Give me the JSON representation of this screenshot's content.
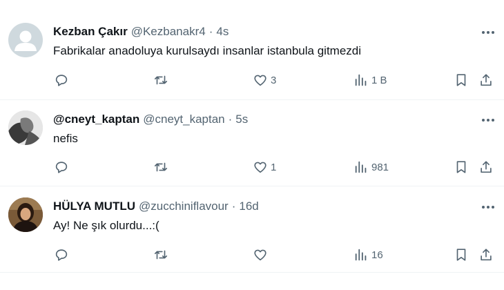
{
  "tweets": [
    {
      "name": "Kezban Çakır",
      "handle": "@Kezbanakr4",
      "separator": "·",
      "time": "4s",
      "text": "Fabrikalar anadoluya kurulsaydı insanlar istanbula gitmezdi",
      "likes": "3",
      "views": "1 B",
      "avatar": "default-avatar-icon"
    },
    {
      "name": "@cneyt_kaptan",
      "handle": "@cneyt_kaptan",
      "separator": "·",
      "time": "5s",
      "text": "nefis",
      "likes": "1",
      "views": "981",
      "avatar": "bw-photo-avatar"
    },
    {
      "name": "HÜLYA MUTLU",
      "handle": "@zucchiniflavour",
      "separator": "·",
      "time": "16d",
      "text": "Ay! Ne şık olurdu...:(",
      "likes": "",
      "views": "16",
      "avatar": "photo-avatar"
    }
  ],
  "colors": {
    "text": "#0f1419",
    "muted": "#536471",
    "divider": "#eff3f4",
    "default_avatar_bg": "#cfd9de"
  },
  "icons": [
    "reply-icon",
    "retweet-icon",
    "like-icon",
    "views-icon",
    "bookmark-icon",
    "share-icon",
    "more-icon"
  ]
}
